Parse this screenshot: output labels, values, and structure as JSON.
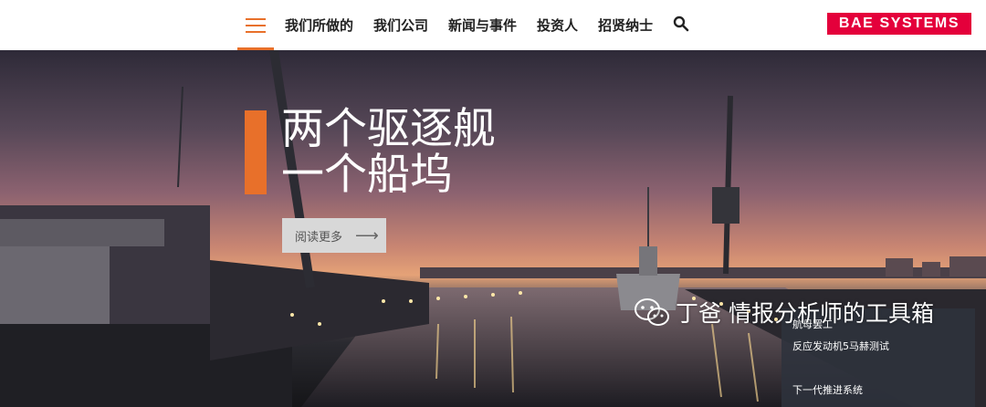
{
  "nav": {
    "menu_icon": "hamburger-menu-icon",
    "items": [
      {
        "label": "我们所做的"
      },
      {
        "label": "我们公司"
      },
      {
        "label": "新闻与事件"
      },
      {
        "label": "投资人"
      },
      {
        "label": "招贤纳士"
      }
    ],
    "search_icon": "search-icon",
    "logo": "BAE SYSTEMS",
    "logo_color": "#e4003b",
    "accent_color": "#e8702a"
  },
  "hero": {
    "title_line1": "两个驱逐舰",
    "title_line2": "一个船坞",
    "read_more_label": "阅读更多",
    "read_more_icon": "arrow-right-icon"
  },
  "side_panel": {
    "items": [
      {
        "label": "航母罢工"
      },
      {
        "label": "反应发动机5马赫测试"
      },
      {
        "label": ""
      },
      {
        "label": "下一代推进系统"
      }
    ]
  },
  "watermark": {
    "icon": "wechat-icon",
    "text": "丁爸 情报分析师的工具箱"
  }
}
